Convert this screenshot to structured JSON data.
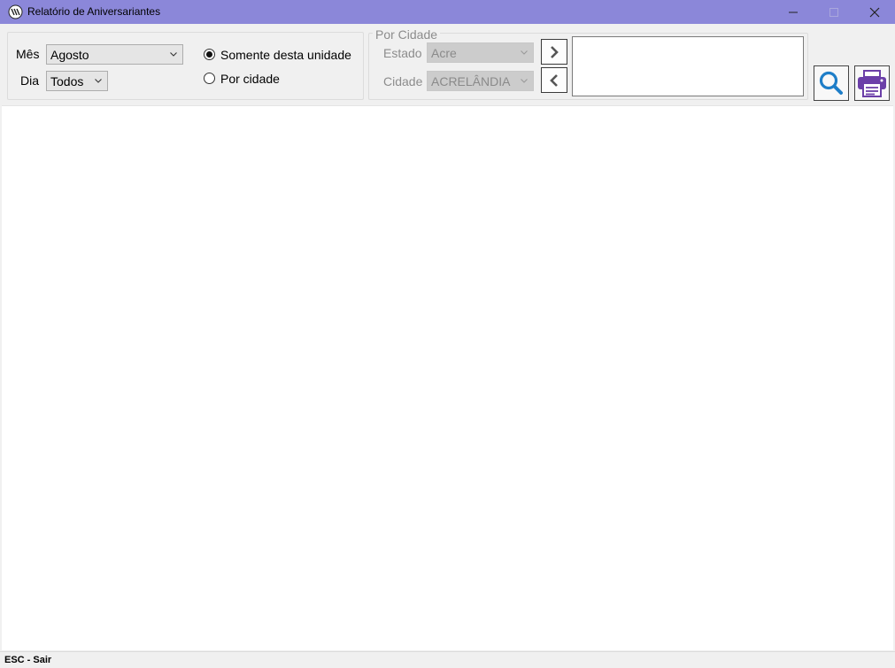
{
  "window": {
    "title": "Relatório de Aniversariantes",
    "titlebar_color": "#8b87d9",
    "app_icon": "app-logo-icon",
    "minimize_icon": "minimize-icon",
    "maximize_icon": "maximize-icon",
    "close_icon": "close-icon"
  },
  "filters": {
    "mes_label": "Mês",
    "mes_value": "Agosto",
    "dia_label": "Dia",
    "dia_value": "Todos",
    "radio_somente": "Somente desta unidade",
    "radio_somente_checked": true,
    "radio_cidade": "Por cidade",
    "radio_cidade_checked": false
  },
  "por_cidade": {
    "caption": "Por Cidade",
    "estado_label": "Estado",
    "estado_value": "Acre",
    "cidade_label": "Cidade",
    "cidade_value": "ACRELÂNDIA",
    "add_icon": "chevron-right-icon",
    "remove_icon": "chevron-left-icon",
    "selected_cities": []
  },
  "actions": {
    "search_icon": "search-icon",
    "search_color": "#1e7ec8",
    "print_icon": "printer-icon",
    "print_color": "#6b3fa8"
  },
  "status": {
    "text": "ESC - Sair"
  }
}
